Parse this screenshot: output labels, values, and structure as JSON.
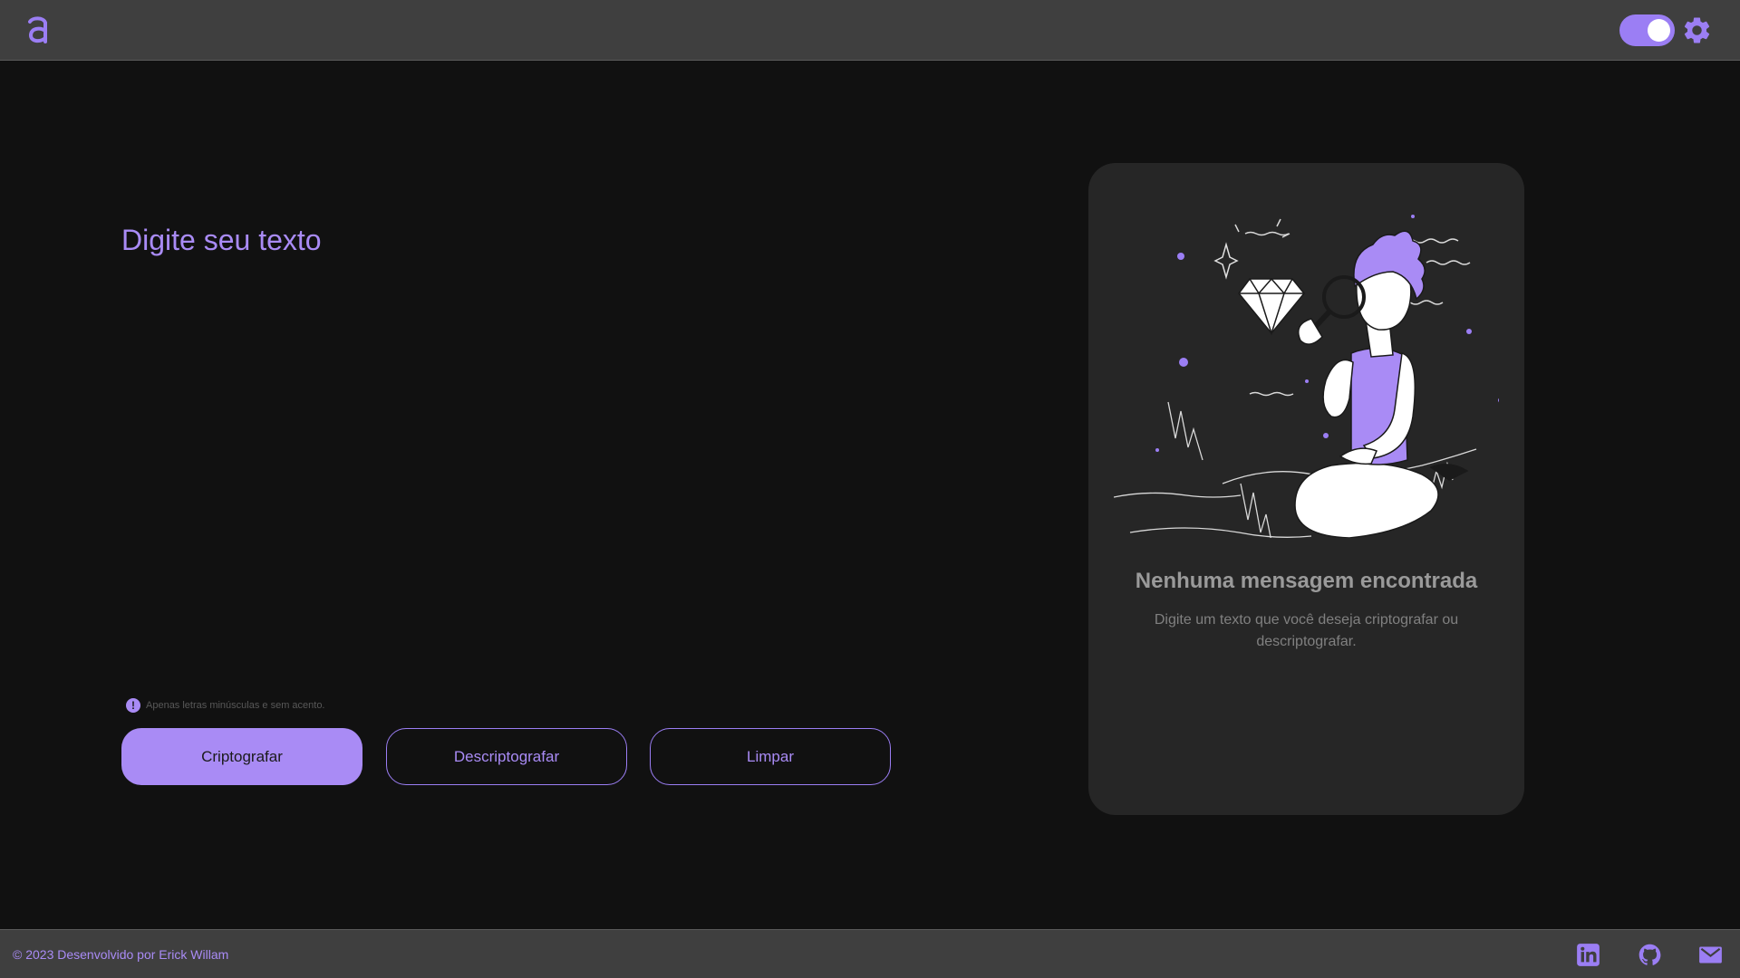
{
  "header": {
    "logo": "a-logo-icon",
    "theme_toggle": {
      "state": "on"
    },
    "settings_icon": "gear-icon"
  },
  "input": {
    "placeholder": "Digite seu texto",
    "hint": "Apenas letras minúsculas e sem acento."
  },
  "buttons": {
    "encrypt": "Criptografar",
    "decrypt": "Descriptografar",
    "clear": "Limpar"
  },
  "output": {
    "title": "Nenhuma mensagem encontrada",
    "description": "Digite um texto que você deseja criptografar ou descriptografar.",
    "illustration": "person-with-magnifier-and-diamond"
  },
  "footer": {
    "credit": "© 2023 Desenvolvido por Erick Willam",
    "links": [
      "linkedin-icon",
      "github-icon",
      "mail-icon"
    ]
  },
  "colors": {
    "accent": "#A98BF5",
    "background": "#111111",
    "bar": "#3F3F3F",
    "card": "#262626"
  }
}
